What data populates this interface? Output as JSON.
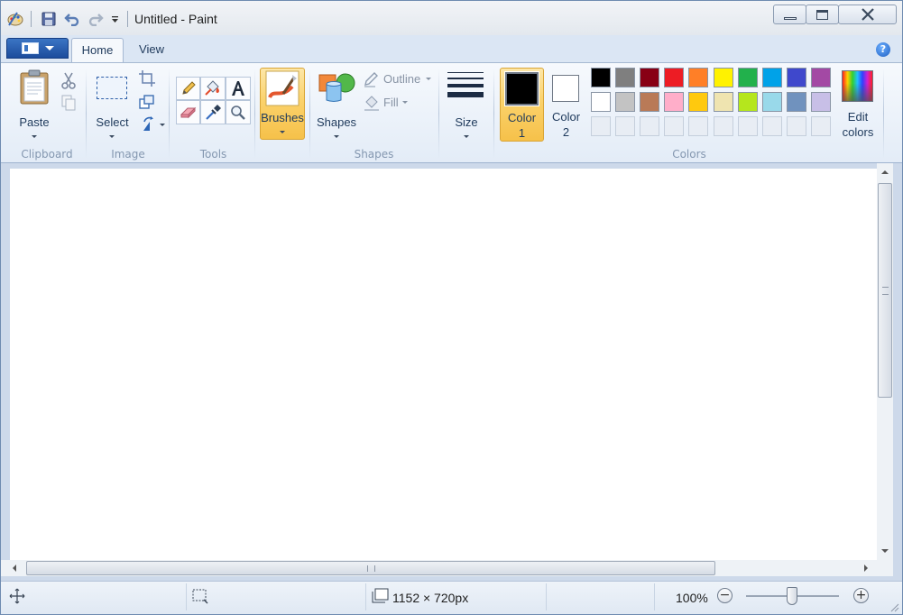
{
  "window": {
    "title": "Untitled - Paint"
  },
  "tabs": [
    {
      "label": "Home",
      "active": true
    },
    {
      "label": "View",
      "active": false
    }
  ],
  "ribbon": {
    "clipboard": {
      "paste_label": "Paste",
      "group_label": "Clipboard"
    },
    "image": {
      "select_label": "Select",
      "group_label": "Image"
    },
    "tools": {
      "group_label": "Tools"
    },
    "brushes": {
      "label": "Brushes"
    },
    "shapes": {
      "shapes_label": "Shapes",
      "outline_label": "Outline",
      "fill_label": "Fill",
      "group_label": "Shapes"
    },
    "size": {
      "label": "Size"
    },
    "colors": {
      "color1_label": "Color",
      "color1_num": "1",
      "color2_label": "Color",
      "color2_num": "2",
      "edit_label": "Edit",
      "edit_label2": "colors",
      "group_label": "Colors",
      "color1_value": "#000000",
      "color2_value": "#ffffff",
      "palette_row1": [
        "#000000",
        "#7f7f7f",
        "#880015",
        "#ed1c24",
        "#ff7f27",
        "#fff200",
        "#22b14c",
        "#00a2e8",
        "#3f48cc",
        "#a349a4"
      ],
      "palette_row2": [
        "#ffffff",
        "#c3c3c3",
        "#b97a57",
        "#ffaec9",
        "#ffc90e",
        "#efe4b0",
        "#b5e61d",
        "#99d9ea",
        "#7092be",
        "#c8bfe7"
      ]
    }
  },
  "status": {
    "image_size": "1152 × 720px",
    "zoom": "100%",
    "zoom_level": 1.0
  }
}
